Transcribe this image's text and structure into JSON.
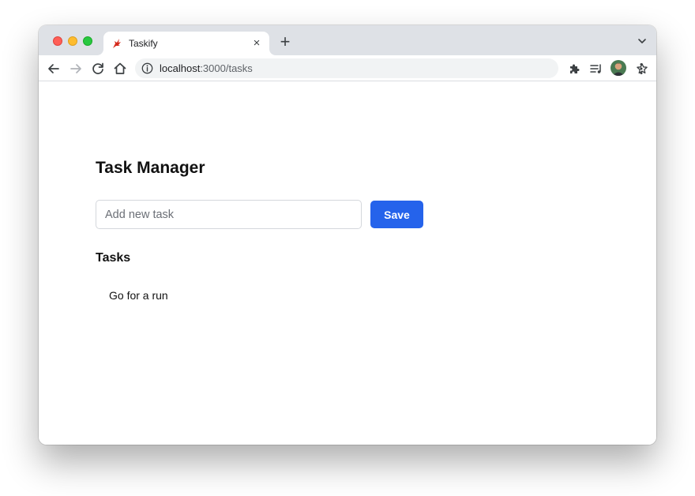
{
  "browser": {
    "tab": {
      "title": "Taskify",
      "close_glyph": "×",
      "favicon": "taskify-logo-icon"
    },
    "new_tab_glyph": "+",
    "url_host": "localhost",
    "url_rest": ":3000/tasks",
    "icons": [
      "back-arrow-icon",
      "forward-arrow-icon",
      "reload-icon",
      "home-icon",
      "info-icon",
      "share-icon",
      "star-icon",
      "extensions-icon",
      "media-icon",
      "profile-avatar",
      "kebab-menu-icon",
      "chevron-down-icon"
    ]
  },
  "page": {
    "title": "Task Manager",
    "input_placeholder": "Add new task",
    "save_label": "Save",
    "tasks_heading": "Tasks",
    "tasks": [
      "Go for a run"
    ]
  },
  "colors": {
    "accent": "#2563eb",
    "tabstrip": "#dee1e6",
    "omnibox": "#f1f3f4"
  }
}
